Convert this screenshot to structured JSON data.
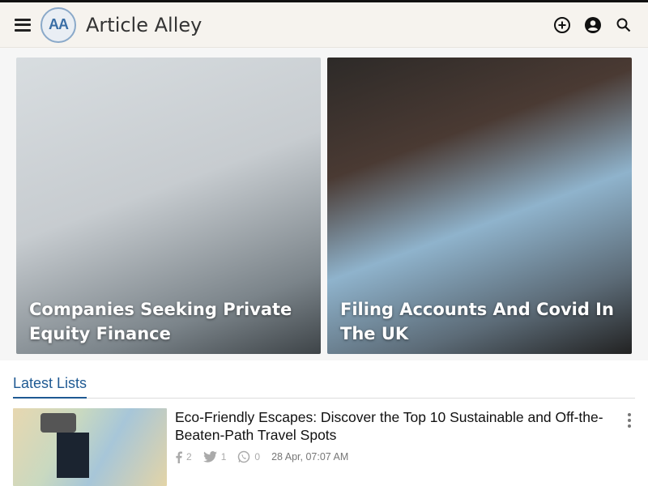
{
  "header": {
    "logo_badge": "AA",
    "logo_text": "Article Alley"
  },
  "hero": {
    "cards": [
      {
        "title": "Companies Seeking Private Equity Finance"
      },
      {
        "title": "Filing Accounts And Covid In The UK"
      }
    ]
  },
  "latest": {
    "heading": "Latest Lists",
    "items": [
      {
        "title": "Eco-Friendly Escapes: Discover the Top 10 Sustainable and Off-the-Beaten-Path Travel Spots",
        "facebook_count": "2",
        "twitter_count": "1",
        "whatsapp_count": "0",
        "date": "28 Apr, 07:07 AM"
      }
    ]
  },
  "icons": {
    "menu": "hamburger-menu-icon",
    "add": "plus-circle-icon",
    "account": "user-circle-icon",
    "search": "search-icon",
    "facebook": "facebook-icon",
    "twitter": "twitter-icon",
    "whatsapp": "whatsapp-icon",
    "more": "kebab-menu-icon"
  },
  "colors": {
    "accent": "#1f5a93",
    "header_bg": "#f6f3ee"
  }
}
